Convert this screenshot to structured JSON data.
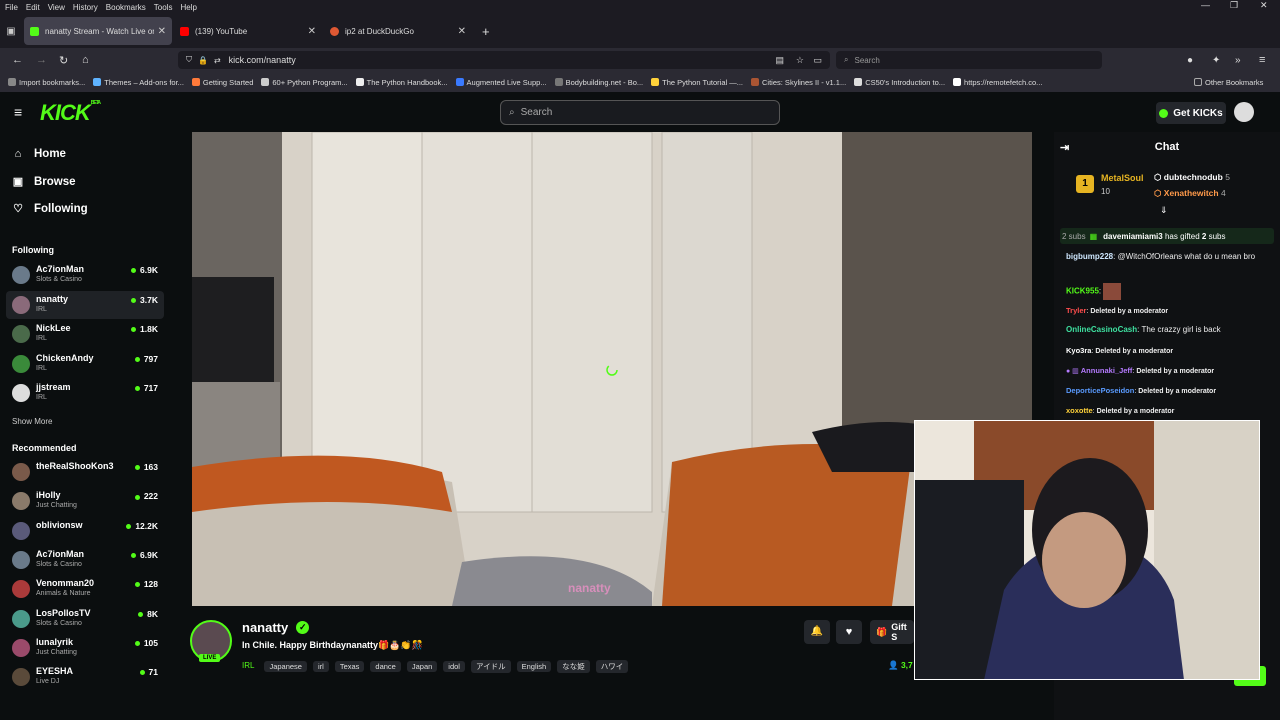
{
  "menu": [
    "File",
    "Edit",
    "View",
    "History",
    "Bookmarks",
    "Tools",
    "Help"
  ],
  "tabs": [
    {
      "title": "nanatty Stream - Watch Live on Kick",
      "color": "#53fc18",
      "active": true
    },
    {
      "title": "(139) YouTube",
      "color": "#ff0000",
      "active": false
    },
    {
      "title": "ip2 at DuckDuckGo",
      "color": "#de5833",
      "active": false
    }
  ],
  "url": "kick.com/nanatty",
  "browser_search_placeholder": "Search",
  "bookmarks": [
    "Import bookmarks...",
    "Themes – Add-ons for...",
    "Getting Started",
    "60+ Python Program...",
    "The Python Handbook...",
    "Augmented Live Supp...",
    "Bodybuilding.net - Bo...",
    "The Python Tutorial —...",
    "Cities: Skylines II - v1.1...",
    "CS50's Introduction to...",
    "https://remotefetch.co...",
    "Other Bookmarks"
  ],
  "kick": {
    "logo": "KICK",
    "beta": "BETA",
    "search_placeholder": "Search",
    "get_kicks": "Get KICKs"
  },
  "sidebar": {
    "nav": [
      "Home",
      "Browse",
      "Following"
    ],
    "following_title": "Following",
    "following": [
      {
        "name": "Ac7ionMan",
        "cat": "Slots & Casino",
        "viewers": "6.9K",
        "color": "#6a7a8a"
      },
      {
        "name": "nanatty",
        "cat": "IRL",
        "viewers": "3.7K",
        "color": "#8a6a7a",
        "selected": true
      },
      {
        "name": "NickLee",
        "cat": "IRL",
        "viewers": "1.8K",
        "color": "#4a6a4a"
      },
      {
        "name": "ChickenAndy",
        "cat": "IRL",
        "viewers": "797",
        "color": "#3a8a3a"
      },
      {
        "name": "jjstream",
        "cat": "IRL",
        "viewers": "717",
        "color": "#dddddd"
      }
    ],
    "show_more": "Show More",
    "recommended_title": "Recommended",
    "recommended": [
      {
        "name": "theRealShooKon3",
        "cat": "",
        "viewers": "163",
        "color": "#7a5a4a"
      },
      {
        "name": "iHolly",
        "cat": "Just Chatting",
        "viewers": "222",
        "color": "#8a7a6a"
      },
      {
        "name": "oblivionsw",
        "cat": "",
        "viewers": "12.2K",
        "color": "#5a5a7a"
      },
      {
        "name": "Ac7ionMan",
        "cat": "Slots & Casino",
        "viewers": "6.9K",
        "color": "#6a7a8a"
      },
      {
        "name": "Venomman20",
        "cat": "Animals & Nature",
        "viewers": "128",
        "color": "#aa3a3a"
      },
      {
        "name": "LosPollosTV",
        "cat": "Slots & Casino",
        "viewers": "8K",
        "color": "#4a9a8a"
      },
      {
        "name": "lunalyrik",
        "cat": "Just Chatting",
        "viewers": "105",
        "color": "#9a4a6a"
      },
      {
        "name": "EYESHA",
        "cat": "Live DJ",
        "viewers": "71",
        "color": "#5a4a3a"
      }
    ]
  },
  "stream": {
    "name": "nanatty",
    "live": "LIVE",
    "title": "In Chile. Happy Birthdaynanatty🎁🎂👏🎊",
    "category": "IRL",
    "tags": [
      "Japanese",
      "irl",
      "Texas",
      "dance",
      "Japan",
      "idol",
      "アイドル",
      "English",
      "なな姫",
      "ハワイ"
    ],
    "gift_label": "Gift S",
    "viewer_count": "3,7",
    "watermark": "nanatty"
  },
  "chat": {
    "title": "Chat",
    "top_gifters": [
      {
        "name": "MetalSoul",
        "count": "10"
      },
      {
        "name": "dubtechnodub",
        "count": "5"
      },
      {
        "name": "Xenathewitch",
        "count": "4"
      }
    ],
    "gift_banner": {
      "subs": "2 subs",
      "user": "davemiamiami3",
      "text": "has gifted",
      "count": "2",
      "unit": "subs"
    },
    "messages": [
      {
        "user": "bigbump228",
        "color": "#cfe8ff",
        "text": "@WitchOfOrleans what do u mean bro"
      },
      {
        "user": "KICK955",
        "color": "#53fc18",
        "text": ""
      },
      {
        "user": "Tryler",
        "color": "#ff4d4d",
        "text": "Deleted by a moderator"
      },
      {
        "user": "OnlineCasinoCash",
        "color": "#3ee0a0",
        "text": "The crazzy girl is back"
      },
      {
        "user": "Kyo3ra",
        "color": "#ffffff",
        "text": "Deleted by a moderator"
      },
      {
        "user": "Annunaki_Jeff",
        "color": "#b57bff",
        "text": "Deleted by a moderator"
      },
      {
        "user": "DeporticePoseidon",
        "color": "#5a9bff",
        "text": "Deleted by a moderator"
      },
      {
        "user": "xoxotte",
        "color": "#ffd23a",
        "text": "Deleted by a moderator"
      }
    ]
  }
}
